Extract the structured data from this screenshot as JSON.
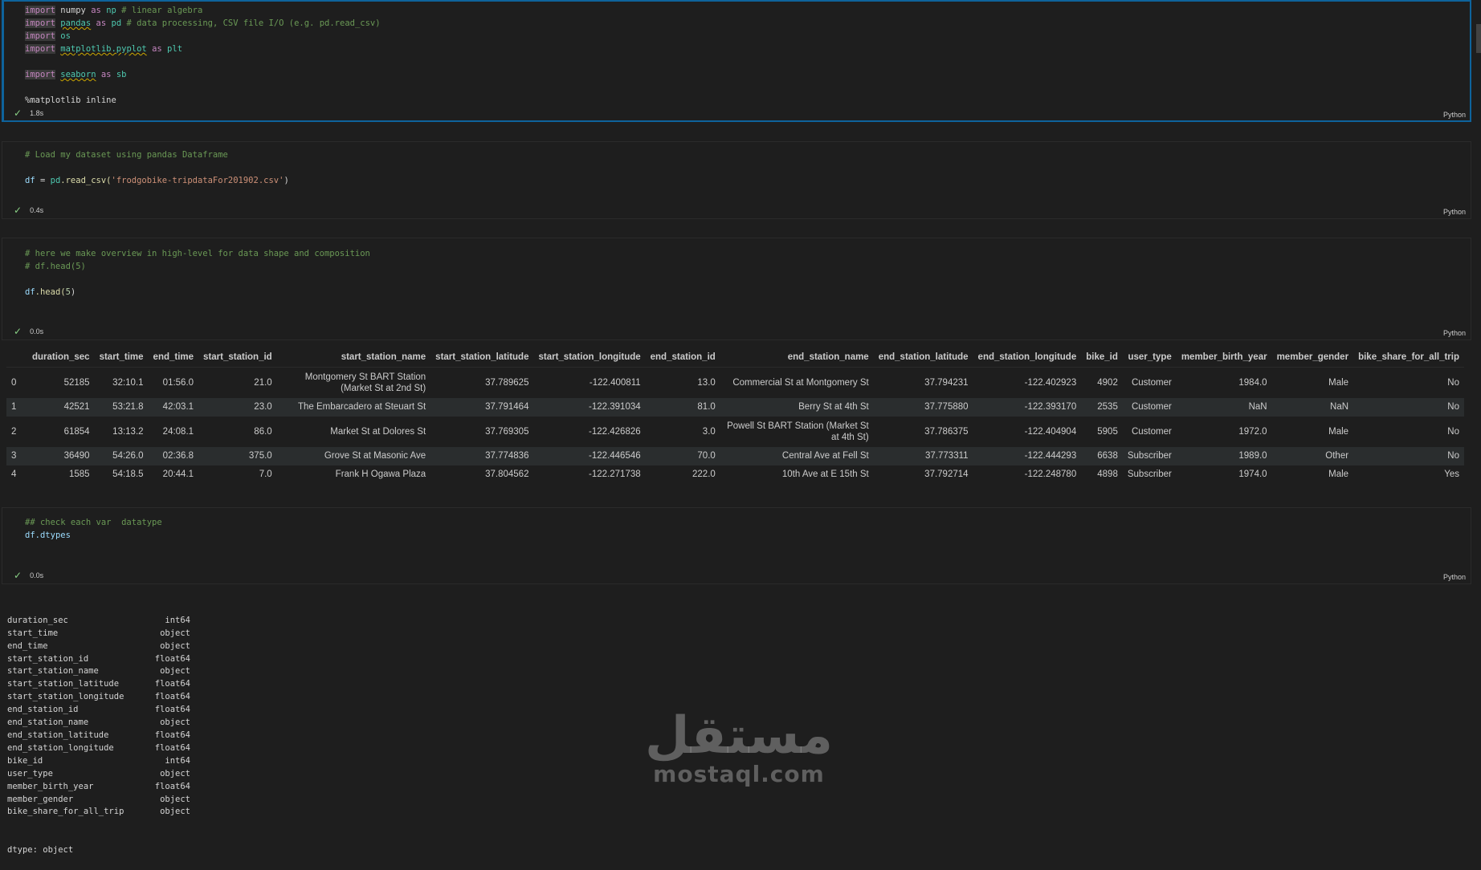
{
  "cells": [
    {
      "status_time": "1.8s",
      "language": "Python",
      "lines": [
        {
          "kw": "import",
          "mod": "numpy",
          "as": "as",
          "alias": "np",
          "comment": "# linear algebra"
        },
        {
          "kw": "import",
          "mod": "pandas",
          "as": "as",
          "alias": "pd",
          "comment": "# data processing, CSV file I/O (e.g. pd.read_csv)"
        },
        {
          "kw": "import",
          "mod": "os"
        },
        {
          "kw": "import",
          "mod": "matplotlib.pyplot",
          "as": "as",
          "alias": "plt"
        },
        {
          "kw": "import",
          "mod": "seaborn",
          "as": "as",
          "alias": "sb"
        },
        {
          "magic": "%matplotlib inline"
        }
      ]
    },
    {
      "status_time": "0.4s",
      "language": "Python",
      "comment": "# Load my dataset using pandas Dataframe",
      "code_var": "df",
      "code_eq": " = ",
      "code_mod": "pd",
      "code_fn": ".read_csv(",
      "code_str": "'frodgobike-tripdataFor201902.csv'",
      "code_end": ")"
    },
    {
      "status_time": "0.0s",
      "language": "Python",
      "comment1": "# here we make overview in high-level for data shape and composition",
      "comment2": "# df.head(5)",
      "code_var": "df",
      "code_fn": ".head(",
      "code_num": "5",
      "code_end": ")"
    },
    {
      "status_time": "0.0s",
      "language": "Python",
      "comment": "## check each var  datatype",
      "code_var": "df",
      "code_rest": ".dtypes"
    }
  ],
  "table": {
    "columns": [
      "",
      "duration_sec",
      "start_time",
      "end_time",
      "start_station_id",
      "start_station_name",
      "start_station_latitude",
      "start_station_longitude",
      "end_station_id",
      "end_station_name",
      "end_station_latitude",
      "end_station_longitude",
      "bike_id",
      "user_type",
      "member_birth_year",
      "member_gender",
      "bike_share_for_all_trip"
    ],
    "rows": [
      [
        "0",
        "52185",
        "32:10.1",
        "01:56.0",
        "21.0",
        "Montgomery St BART Station (Market St at 2nd St)",
        "37.789625",
        "-122.400811",
        "13.0",
        "Commercial St at Montgomery St",
        "37.794231",
        "-122.402923",
        "4902",
        "Customer",
        "1984.0",
        "Male",
        "No"
      ],
      [
        "1",
        "42521",
        "53:21.8",
        "42:03.1",
        "23.0",
        "The Embarcadero at Steuart St",
        "37.791464",
        "-122.391034",
        "81.0",
        "Berry St at 4th St",
        "37.775880",
        "-122.393170",
        "2535",
        "Customer",
        "NaN",
        "NaN",
        "No"
      ],
      [
        "2",
        "61854",
        "13:13.2",
        "24:08.1",
        "86.0",
        "Market St at Dolores St",
        "37.769305",
        "-122.426826",
        "3.0",
        "Powell St BART Station (Market St at 4th St)",
        "37.786375",
        "-122.404904",
        "5905",
        "Customer",
        "1972.0",
        "Male",
        "No"
      ],
      [
        "3",
        "36490",
        "54:26.0",
        "02:36.8",
        "375.0",
        "Grove St at Masonic Ave",
        "37.774836",
        "-122.446546",
        "70.0",
        "Central Ave at Fell St",
        "37.773311",
        "-122.444293",
        "6638",
        "Subscriber",
        "1989.0",
        "Other",
        "No"
      ],
      [
        "4",
        "1585",
        "54:18.5",
        "20:44.1",
        "7.0",
        "Frank H Ogawa Plaza",
        "37.804562",
        "-122.271738",
        "222.0",
        "10th Ave at E 15th St",
        "37.792714",
        "-122.248780",
        "4898",
        "Subscriber",
        "1974.0",
        "Male",
        "Yes"
      ]
    ]
  },
  "dtypes": [
    [
      "duration_sec",
      "int64"
    ],
    [
      "start_time",
      "object"
    ],
    [
      "end_time",
      "object"
    ],
    [
      "start_station_id",
      "float64"
    ],
    [
      "start_station_name",
      "object"
    ],
    [
      "start_station_latitude",
      "float64"
    ],
    [
      "start_station_longitude",
      "float64"
    ],
    [
      "end_station_id",
      "float64"
    ],
    [
      "end_station_name",
      "object"
    ],
    [
      "end_station_latitude",
      "float64"
    ],
    [
      "end_station_longitude",
      "float64"
    ],
    [
      "bike_id",
      "int64"
    ],
    [
      "user_type",
      "object"
    ],
    [
      "member_birth_year",
      "float64"
    ],
    [
      "member_gender",
      "object"
    ],
    [
      "bike_share_for_all_trip",
      "object"
    ]
  ],
  "dtype_footer": "dtype: object",
  "watermark": {
    "arabic": "مستقل",
    "latin": "mostaql.com"
  }
}
